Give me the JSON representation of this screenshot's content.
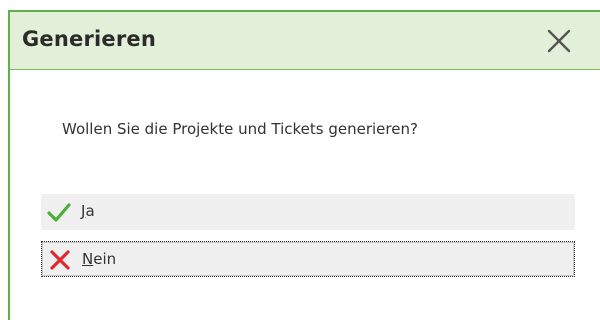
{
  "dialog": {
    "title": "Generieren",
    "message": "Wollen Sie die Projekte und Tickets generieren?",
    "options": [
      {
        "mnemonic": "J",
        "rest": "a",
        "icon": "checkmark-icon",
        "color": "#4caf3a"
      },
      {
        "mnemonic": "N",
        "rest": "ein",
        "icon": "cross-icon",
        "color": "#e0282e"
      }
    ],
    "close_icon": "close-icon"
  },
  "colors": {
    "titlebar_bg": "#e2f0d9",
    "border": "#62b045",
    "option_bg": "#f0f0f0"
  }
}
